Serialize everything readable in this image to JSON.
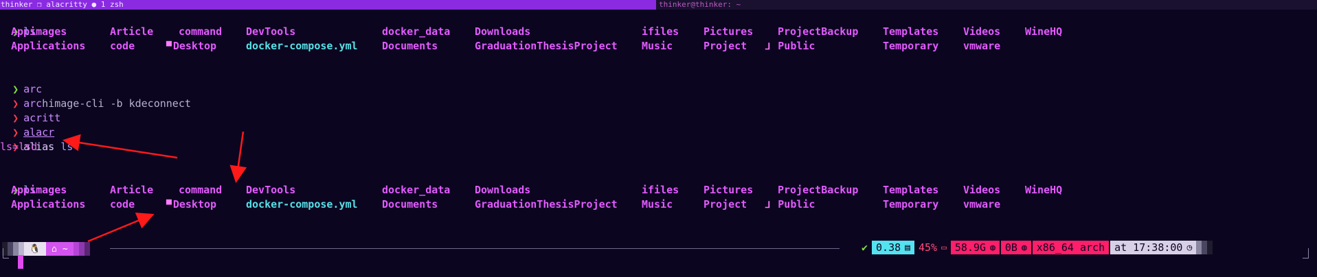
{
  "titlebar": {
    "left_text": "thinker ❐ alacritty ● 1 zsh",
    "right_text": "thinker@thinker: ~"
  },
  "terminal": {
    "prompt_glyph": "❯",
    "block1": {
      "command": "ls"
    },
    "ls_listing": {
      "row1": [
        "Appimages",
        "Article",
        "command",
        "DevTools",
        "docker_data",
        "Downloads",
        "ifiles",
        "Pictures",
        "ProjectBackup",
        "Templates",
        "Videos",
        "WineHQ"
      ],
      "row2": [
        "Applications",
        "code",
        "Desktop",
        "docker-compose.yml",
        "Documents",
        "GraduationThesisProject",
        "Music",
        "Project",
        "Public",
        "Temporary",
        "vmware"
      ]
    },
    "history": [
      {
        "status": "ok",
        "typed": "arc",
        "rest": ""
      },
      {
        "status": "error",
        "typed": "arc",
        "rest": "himage-cli -b kdeconnect"
      },
      {
        "status": "error",
        "typed": "acritt",
        "rest": ""
      },
      {
        "status": "error",
        "typed": "alacr",
        "rest": ""
      },
      {
        "status": "error",
        "typed": "alias",
        "rest": " ls"
      }
    ],
    "alias_output": "ls=lsd",
    "block2": {
      "command": "ls"
    }
  },
  "statusbar": {
    "home_label": "~",
    "check": "✔",
    "load": "0.38",
    "mem": "45%",
    "disk": "58.9G",
    "net": "0B",
    "arch": "x86_64 arch",
    "time": "at 17:38:00"
  },
  "colors": {
    "background": "#0c0520",
    "dir": "#e35bff",
    "file": "#58e0e6",
    "ok": "#7ee03f",
    "error": "#ff3b4a",
    "status_pink": "#ff1e6a",
    "status_cyan": "#53e3f0",
    "annotation_arrow": "#ff1a1a"
  },
  "icons": {
    "desktop": "monitor-icon",
    "public": "public-icon",
    "linux": "tux-icon",
    "home": "home-icon",
    "load": "bars-icon",
    "memory": "memory-icon",
    "disk": "disk-icon",
    "network": "speed-icon",
    "clock": "clock-icon"
  }
}
